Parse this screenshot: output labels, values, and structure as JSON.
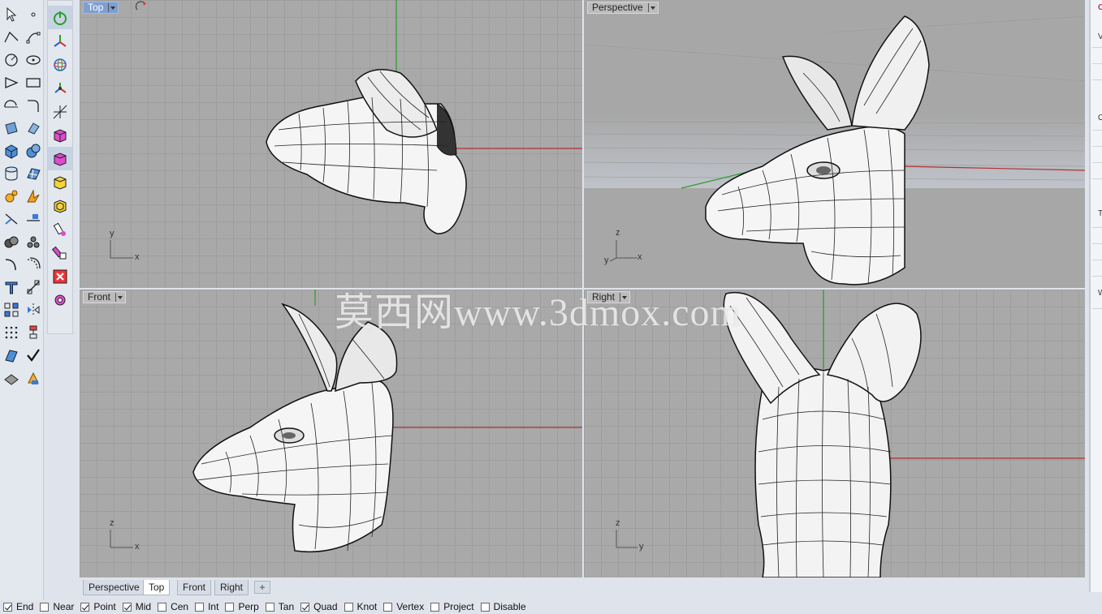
{
  "viewports": {
    "top": {
      "label": "Top",
      "axis_a": "y",
      "axis_b": "x"
    },
    "perspective": {
      "label": "Perspective",
      "axis_a": "z",
      "axis_b": "y",
      "axis_c": "x"
    },
    "front": {
      "label": "Front",
      "axis_a": "z",
      "axis_b": "x"
    },
    "right": {
      "label": "Right",
      "axis_a": "z",
      "axis_b": "y"
    }
  },
  "tabs": [
    "Perspective",
    "Top",
    "Front",
    "Right"
  ],
  "active_tab": "Top",
  "tab_add_label": "+",
  "osnap": [
    {
      "label": "End",
      "checked": true
    },
    {
      "label": "Near",
      "checked": false
    },
    {
      "label": "Point",
      "checked": true
    },
    {
      "label": "Mid",
      "checked": true
    },
    {
      "label": "Cen",
      "checked": false
    },
    {
      "label": "Int",
      "checked": false
    },
    {
      "label": "Perp",
      "checked": false
    },
    {
      "label": "Tan",
      "checked": false
    },
    {
      "label": "Quad",
      "checked": true
    },
    {
      "label": "Knot",
      "checked": false
    },
    {
      "label": "Vertex",
      "checked": false
    },
    {
      "label": "Project",
      "checked": false
    },
    {
      "label": "Disable",
      "checked": false
    }
  ],
  "right_panel_letters": [
    "V",
    "O",
    "T",
    "W"
  ],
  "watermark": "莫西网www.3dmox.com",
  "colors": {
    "viewport_bg": "#a9a9a9",
    "grid": "#9e9e9e",
    "axis_x": "#b03030",
    "axis_y": "#2a9d2a",
    "active_label": "#7e9fd1"
  }
}
